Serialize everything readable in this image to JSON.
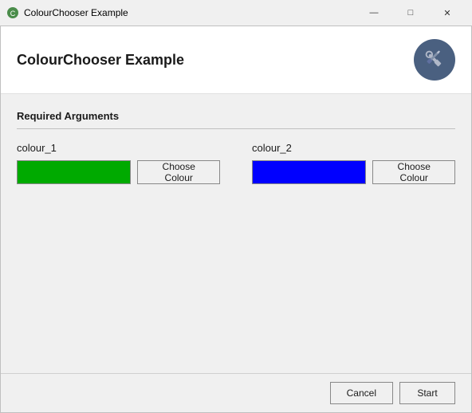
{
  "titlebar": {
    "title": "ColourChooser Example",
    "minimize_label": "—",
    "maximize_label": "□",
    "close_label": "✕"
  },
  "header": {
    "title": "ColourChooser Example"
  },
  "sections": {
    "required_arguments_label": "Required Arguments"
  },
  "arguments": [
    {
      "id": "colour_1",
      "label": "colour_1",
      "colour": "#00aa00",
      "button_label": "Choose Colour"
    },
    {
      "id": "colour_2",
      "label": "colour_2",
      "colour": "#0000ff",
      "button_label": "Choose Colour"
    }
  ],
  "footer": {
    "cancel_label": "Cancel",
    "start_label": "Start"
  }
}
